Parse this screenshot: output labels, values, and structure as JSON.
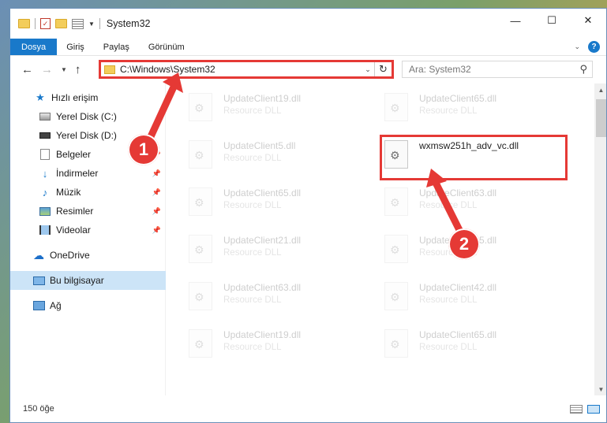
{
  "window": {
    "title": "System32",
    "controls": {
      "minimize": "—",
      "maximize": "☐",
      "close": "✕"
    }
  },
  "ribbon": {
    "tabs": [
      "Dosya",
      "Giriş",
      "Paylaş",
      "Görünüm"
    ],
    "help": "?"
  },
  "navbar": {
    "address": "C:\\Windows\\System32",
    "search_placeholder": "Ara: System32"
  },
  "sidebar": {
    "items": [
      {
        "label": "Hızlı erişim",
        "pinned": false
      },
      {
        "label": "Yerel Disk (C:)",
        "pinned": false
      },
      {
        "label": "Yerel Disk (D:)",
        "pinned": false
      },
      {
        "label": "Belgeler",
        "pinned": true
      },
      {
        "label": "İndirmeler",
        "pinned": true
      },
      {
        "label": "Müzik",
        "pinned": true
      },
      {
        "label": "Resimler",
        "pinned": true
      },
      {
        "label": "Videolar",
        "pinned": true
      },
      {
        "label": "OneDrive",
        "pinned": false
      },
      {
        "label": "Bu bilgisayar",
        "pinned": false
      },
      {
        "label": "Ağ",
        "pinned": false
      }
    ]
  },
  "files": [
    {
      "name": "UpdateClient19.dll",
      "desc": "Resource DLL"
    },
    {
      "name": "UpdateClient65.dll",
      "desc": "Resource DLL"
    },
    {
      "name": "UpdateClient5.dll",
      "desc": "Resource DLL"
    },
    {
      "name": "wxmsw251h_adv_vc.dll",
      "desc": ""
    },
    {
      "name": "UpdateClient65.dll",
      "desc": "Resource DLL"
    },
    {
      "name": "UpdateClient63.dll",
      "desc": "Resource DLL"
    },
    {
      "name": "UpdateClient21.dll",
      "desc": "Resource DLL"
    },
    {
      "name": "UpdateClient65.dll",
      "desc": "Resource DLL"
    },
    {
      "name": "UpdateClient63.dll",
      "desc": "Resource DLL"
    },
    {
      "name": "UpdateClient42.dll",
      "desc": "Resource DLL"
    },
    {
      "name": "UpdateClient19.dll",
      "desc": "Resource DLL"
    },
    {
      "name": "UpdateClient65.dll",
      "desc": "Resource DLL"
    }
  ],
  "status": {
    "item_count": "150 öğe"
  },
  "annotations": {
    "callout_1": "1",
    "callout_2": "2",
    "color": "#e53935"
  },
  "colors": {
    "accent": "#1979ca",
    "selection": "#cce4f7"
  }
}
